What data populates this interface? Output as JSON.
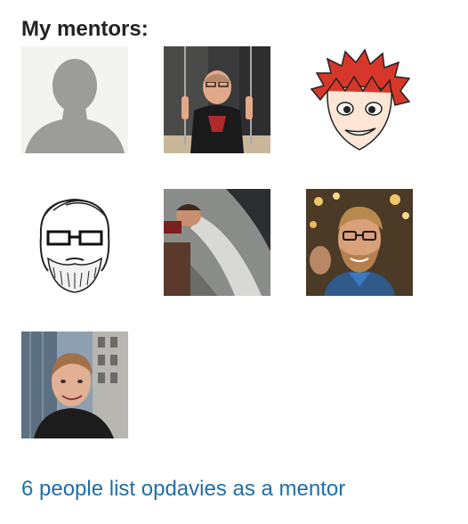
{
  "section": {
    "heading": "My mentors:"
  },
  "mentors": [
    {
      "icon": "default-avatar-silhouette"
    },
    {
      "icon": "photo-man-on-swing"
    },
    {
      "icon": "cartoon-red-hair-avatar"
    },
    {
      "icon": "sketch-bearded-glasses-avatar"
    },
    {
      "icon": "photo-man-in-car-window"
    },
    {
      "icon": "photo-man-glasses-beard"
    },
    {
      "icon": "photo-man-city-street"
    }
  ],
  "footer": {
    "link_label": "6 people list opdavies as a mentor"
  },
  "colors": {
    "link": "#1f6fa8",
    "heading": "#222222"
  }
}
